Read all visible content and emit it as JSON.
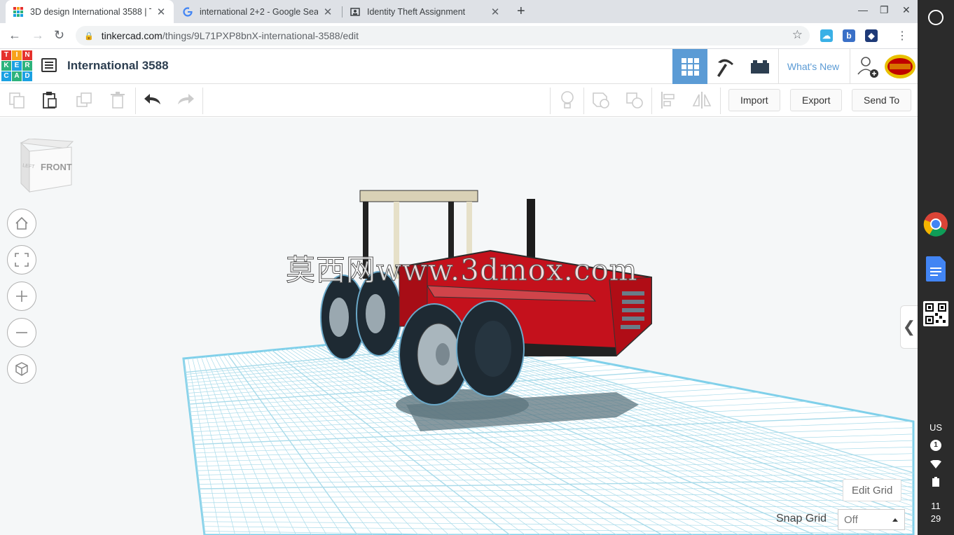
{
  "browser": {
    "tabs": [
      {
        "title": "3D design International 3588 | T",
        "favicon": "tinkercad-icon",
        "active": true
      },
      {
        "title": "international 2+2 - Google Searc",
        "favicon": "google-icon",
        "active": false
      },
      {
        "title": "Identity Theft Assignment",
        "favicon": "classroom-icon",
        "active": false
      }
    ],
    "url_host": "tinkercad.com",
    "url_path": "/things/9L71PXP8bnX-international-3588/edit"
  },
  "header": {
    "logo_letters": [
      "T",
      "I",
      "N",
      "K",
      "E",
      "R",
      "C",
      "A",
      "D"
    ],
    "logo_colors": [
      "#e5322d",
      "#f7a21b",
      "#e5322d",
      "#2db37c",
      "#1ba1e2",
      "#2db37c",
      "#1ba1e2",
      "#2db37c",
      "#1ba1e2"
    ],
    "design_name": "International 3588",
    "whats_new": "What's New",
    "accent": "#5b9bd5"
  },
  "toolbar": {
    "import": "Import",
    "export": "Export",
    "send_to": "Send To"
  },
  "viewcube": {
    "front": "FRONT",
    "left": "LEFT"
  },
  "workplane": {
    "watermark": "莫西网www.3dmox.com",
    "edit_grid": "Edit Grid",
    "snap_grid_label": "Snap Grid",
    "snap_grid_value": "Off"
  },
  "shelf": {
    "keyboard": "US",
    "notifications": "1",
    "clock_hour": "11",
    "clock_min": "29"
  }
}
